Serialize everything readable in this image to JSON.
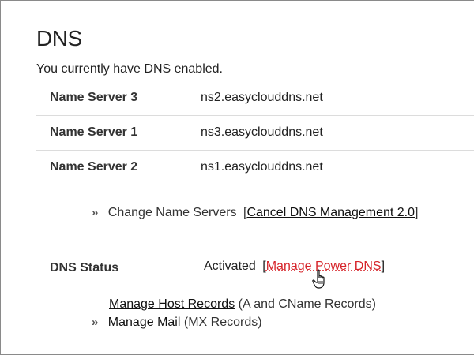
{
  "page": {
    "title": "DNS",
    "intro": "You currently have DNS enabled."
  },
  "name_servers": [
    {
      "label": "Name Server 3",
      "value": "ns2.easyclouddns.net"
    },
    {
      "label": "Name Server 1",
      "value": "ns3.easyclouddns.net"
    },
    {
      "label": "Name Server 2",
      "value": "ns1.easyclouddns.net"
    }
  ],
  "change_ns": {
    "bullet": "»",
    "text": "Change Name Servers",
    "open_bracket": "[",
    "link": "Cancel DNS Management 2.0",
    "close_bracket": "]"
  },
  "dns_status": {
    "label": "DNS Status",
    "value": "Activated",
    "open_bracket": "[",
    "link": "Manage Power DNS",
    "close_bracket": "]",
    "link_color": "#d6242a"
  },
  "manage": {
    "host_records_link": "Manage Host Records",
    "host_records_note": "(A and CName Records)",
    "bullet": "»",
    "mail_link": "Manage Mail",
    "mail_note": "(MX Records)"
  },
  "cursor": {
    "icon": "hand-pointer-icon"
  }
}
